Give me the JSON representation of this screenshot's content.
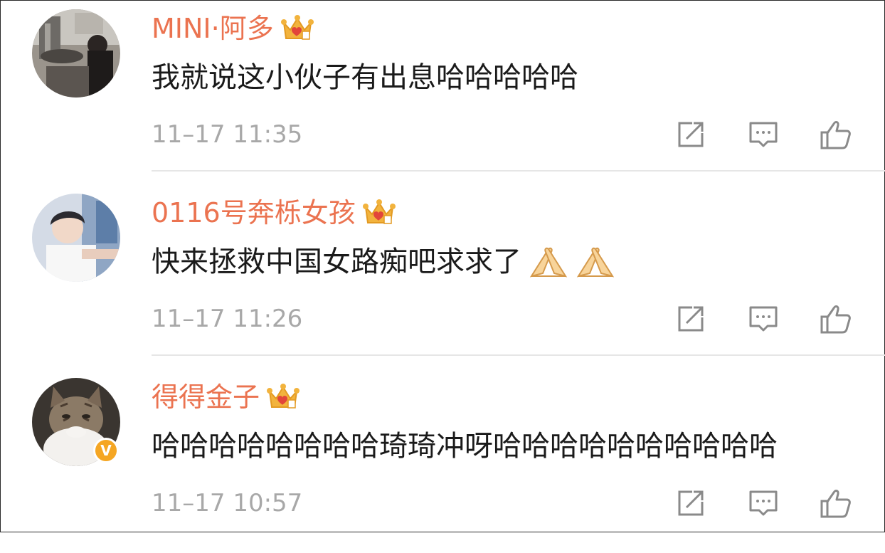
{
  "colors": {
    "username": "#eb7350",
    "text": "#1a1a1a",
    "timestamp": "#a8a8a8",
    "icon": "#8a8a8a",
    "crown_gold": "#f2b33d",
    "crown_red": "#e2453a",
    "verified_badge": "#f5a623",
    "divider": "#e6e6e6"
  },
  "comments": [
    {
      "username": "MINI·阿多",
      "text": "我就说这小伙子有出息哈哈哈哈哈",
      "timestamp": "11–17 11:35",
      "avatar_icon": "avatar-photo",
      "member_icon": "crown-icon",
      "verified": false,
      "emoji": []
    },
    {
      "username": "0116号奔栎女孩",
      "text": "快来拯救中国女路痴吧求求了",
      "timestamp": "11–17 11:26",
      "avatar_icon": "avatar-photo",
      "member_icon": "crown-icon",
      "verified": false,
      "emoji": [
        "pray-emoji",
        "pray-emoji"
      ]
    },
    {
      "username": "得得金子",
      "text": "哈哈哈哈哈哈哈哈琦琦冲呀哈哈哈哈哈哈哈哈哈哈",
      "timestamp": "11–17 10:57",
      "avatar_icon": "avatar-cat-photo",
      "member_icon": "crown-icon",
      "verified": true,
      "verified_label": "V",
      "emoji": []
    }
  ],
  "actions": {
    "share_icon": "share-icon",
    "reply_icon": "comment-icon",
    "like_icon": "thumbs-up-icon"
  }
}
